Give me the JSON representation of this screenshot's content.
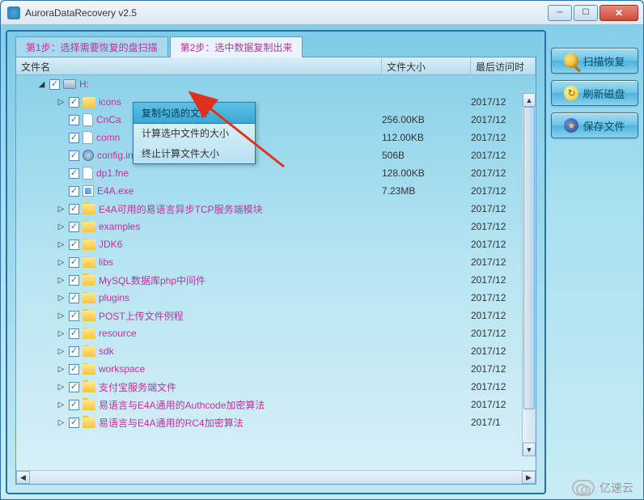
{
  "title": "AuroraDataRecovery v2.5",
  "tabs": [
    {
      "label": "第1步：选择需要恢复的盘扫描"
    },
    {
      "label": "第2步：选中数据复制出来"
    }
  ],
  "columns": {
    "name": "文件名",
    "size": "文件大小",
    "date": "最后访问时"
  },
  "drive": {
    "label": "H:"
  },
  "rows": [
    {
      "name": "icons",
      "type": "folder",
      "size": "",
      "date": "2017/12"
    },
    {
      "name": "CnCa",
      "type": "file",
      "size": "256.00KB",
      "date": "2017/12"
    },
    {
      "name": "comn",
      "type": "file",
      "size": "112.00KB",
      "date": "2017/12"
    },
    {
      "name": "config.ini",
      "type": "ini",
      "size": "506B",
      "date": "2017/12"
    },
    {
      "name": "dp1.fne",
      "type": "file",
      "size": "128.00KB",
      "date": "2017/12"
    },
    {
      "name": "E4A.exe",
      "type": "exe",
      "size": "7.23MB",
      "date": "2017/12"
    },
    {
      "name": "E4A可用的易语言异步TCP服务端模块",
      "type": "folder",
      "size": "",
      "date": "2017/12"
    },
    {
      "name": "examples",
      "type": "folder",
      "size": "",
      "date": "2017/12"
    },
    {
      "name": "JDK6",
      "type": "folder",
      "size": "",
      "date": "2017/12"
    },
    {
      "name": "libs",
      "type": "folder",
      "size": "",
      "date": "2017/12"
    },
    {
      "name": "MySQL数据库php中间件",
      "type": "folder",
      "size": "",
      "date": "2017/12"
    },
    {
      "name": "plugins",
      "type": "folder",
      "size": "",
      "date": "2017/12"
    },
    {
      "name": "POST上传文件例程",
      "type": "folder",
      "size": "",
      "date": "2017/12"
    },
    {
      "name": "resource",
      "type": "folder",
      "size": "",
      "date": "2017/12"
    },
    {
      "name": "sdk",
      "type": "folder",
      "size": "",
      "date": "2017/12"
    },
    {
      "name": "workspace",
      "type": "folder",
      "size": "",
      "date": "2017/12"
    },
    {
      "name": "支付宝服务端文件",
      "type": "folder",
      "size": "",
      "date": "2017/12"
    },
    {
      "name": "易语言与E4A通用的Authcode加密算法",
      "type": "folder",
      "size": "",
      "date": "2017/12"
    },
    {
      "name": "易语言与E4A通用的RC4加密算法",
      "type": "folder",
      "size": "",
      "date": "2017/1"
    }
  ],
  "context_menu": [
    "复制勾选的文件",
    "计算选中文件的大小",
    "终止计算文件大小"
  ],
  "sidebar": {
    "scan": "扫描恢复",
    "refresh": "刷新磁盘",
    "save": "保存文件"
  },
  "watermark": "亿速云"
}
